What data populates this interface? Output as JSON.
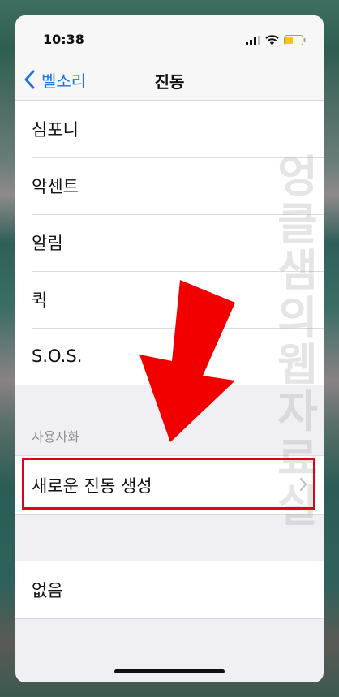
{
  "status": {
    "time": "10:38",
    "icons": [
      "signal-icon",
      "wifi-icon",
      "battery-icon"
    ]
  },
  "nav": {
    "back_label": "벨소리",
    "title": "진동"
  },
  "patterns": [
    {
      "label": "심포니"
    },
    {
      "label": "악센트"
    },
    {
      "label": "알림"
    },
    {
      "label": "퀵"
    },
    {
      "label": "S.O.S."
    }
  ],
  "custom": {
    "header": "사용자화",
    "create_label": "새로운 진동 생성"
  },
  "none": {
    "label": "없음"
  },
  "watermark": "엉클샘의웹자료실",
  "colors": {
    "accent": "#1a73e8",
    "highlight": "#e60012",
    "arrow": "#f20000"
  }
}
